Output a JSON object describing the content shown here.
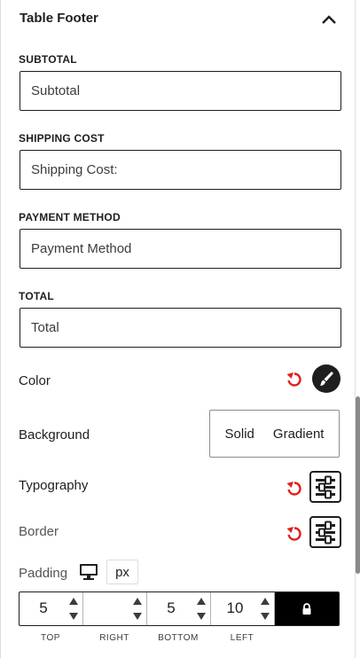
{
  "panel": {
    "title": "Table Footer"
  },
  "fields": {
    "subtotal": {
      "label": "SUBTOTAL",
      "value": "Subtotal"
    },
    "shipping": {
      "label": "SHIPPING COST",
      "value": "Shipping Cost:"
    },
    "payment": {
      "label": "PAYMENT METHOD",
      "value": "Payment Method"
    },
    "total": {
      "label": "TOTAL",
      "value": "Total"
    }
  },
  "color": {
    "label": "Color",
    "swatch": "#1e1e1e",
    "reset_color": "#e02020"
  },
  "background": {
    "label": "Background",
    "options": [
      "Solid",
      "Gradient"
    ]
  },
  "typography": {
    "label": "Typography"
  },
  "border": {
    "label": "Border"
  },
  "padding": {
    "label": "Padding",
    "unit": "px",
    "top": "5",
    "right": "",
    "bottom": "5",
    "left": "10",
    "captions": {
      "top": "TOP",
      "right": "RIGHT",
      "bottom": "BOTTOM",
      "left": "LEFT"
    }
  },
  "icons": {
    "collapse": "chevron-up-icon",
    "reset": "reset-icon",
    "brush": "brush-icon",
    "settings": "sliders-icon",
    "device": "desktop-icon",
    "lock": "lock-icon"
  }
}
